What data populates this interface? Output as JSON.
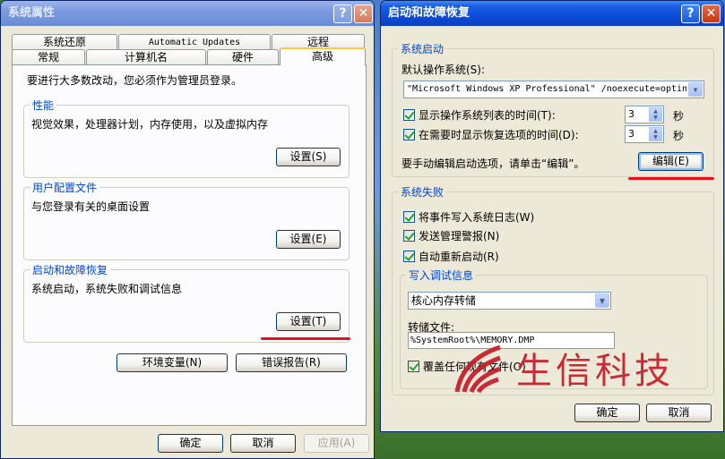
{
  "left_dialog": {
    "title": "系统属性",
    "tabs_row1": [
      "系统还原",
      "Automatic Updates",
      "远程"
    ],
    "tabs_row2": [
      "常规",
      "计算机名",
      "硬件",
      "高级"
    ],
    "intro": "要进行大多数改动，您必须作为管理员登录。",
    "performance": {
      "label": "性能",
      "desc": "视觉效果，处理器计划，内存使用，以及虚拟内存",
      "button": "设置(S)"
    },
    "user_profiles": {
      "label": "用户配置文件",
      "desc": "与您登录有关的桌面设置",
      "button": "设置(E)"
    },
    "startup_recovery": {
      "label": "启动和故障恢复",
      "desc": "系统启动，系统失败和调试信息",
      "button": "设置(T)"
    },
    "env_button": "环境变量(N)",
    "error_report_button": "错误报告(R)",
    "ok": "确定",
    "cancel": "取消",
    "apply": "应用(A)"
  },
  "right_dialog": {
    "title": "启动和故障恢复",
    "system_startup": {
      "label": "系统启动",
      "default_os_label": "默认操作系统(S):",
      "default_os_value": "\"Microsoft Windows XP Professional\" /noexecute=optin",
      "show_list_label": "显示操作系统列表的时间(T):",
      "show_list_value": "3",
      "show_recovery_label": "在需要时显示恢复选项的时间(D):",
      "show_recovery_value": "3",
      "seconds": "秒",
      "edit_hint": "要手动编辑启动选项，请单击“编辑”。",
      "edit_button": "编辑(E)"
    },
    "system_failure": {
      "label": "系统失败",
      "write_log": "将事件写入系统日志(W)",
      "send_alert": "发送管理警报(N)",
      "auto_restart": "自动重新启动(R)",
      "debug_label": "写入调试信息",
      "debug_value": "核心内存转储",
      "dump_file_label": "转储文件:",
      "dump_file_value": "%SystemRoot%\\MEMORY.DMP",
      "overwrite": "覆盖任何现有文件(O)"
    },
    "ok": "确定",
    "cancel": "取消"
  },
  "watermark": {
    "text": "生信科技"
  },
  "colors": {
    "accent_red": "#e8101a",
    "group_label": "#0046d5",
    "title_blue": "#0a4cd7"
  }
}
